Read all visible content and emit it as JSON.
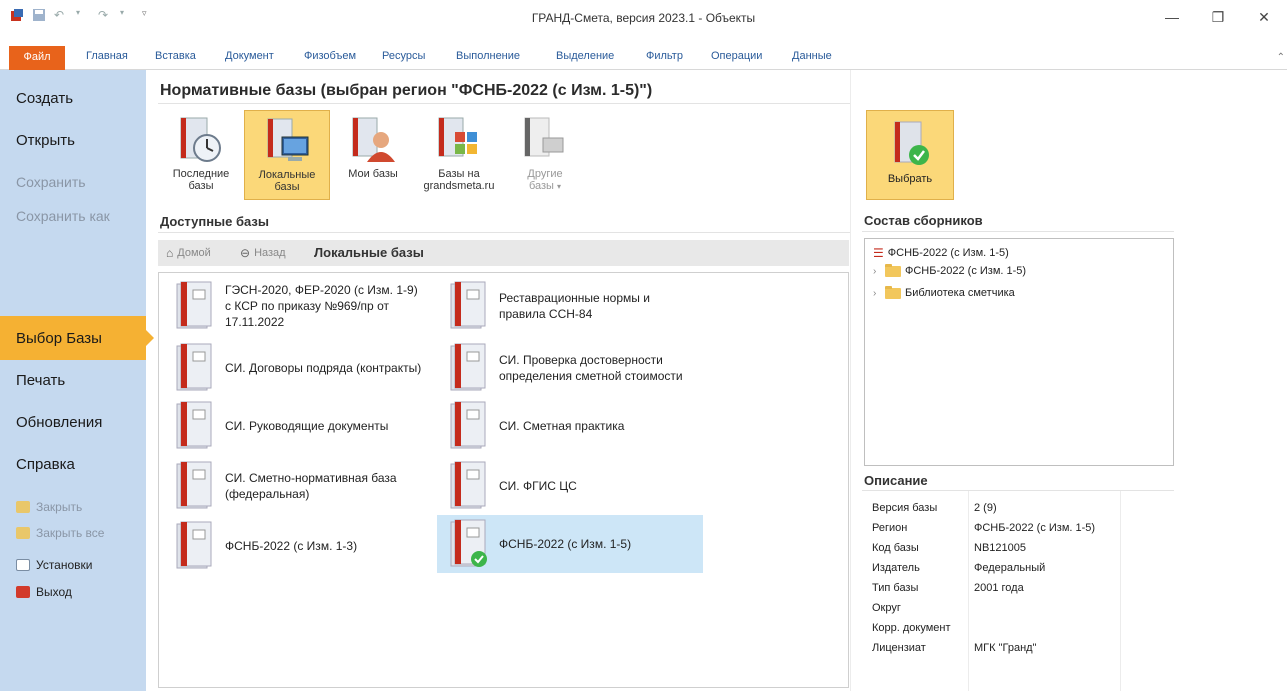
{
  "window": {
    "title": "ГРАНД-Смета, версия 2023.1 - Объекты",
    "minimize": "—",
    "restore": "❐",
    "close": "✕"
  },
  "ribbon": {
    "file_tab": "Файл",
    "tabs": [
      "Главная",
      "Вставка",
      "Документ",
      "Физобъем",
      "Ресурсы",
      "Выполнение",
      "Выделение",
      "Фильтр",
      "Операции",
      "Данные"
    ]
  },
  "nav": {
    "items": [
      "Создать",
      "Открыть",
      "Сохранить",
      "Сохранить как",
      "Выбор Базы",
      "Печать",
      "Обновления",
      "Справка"
    ],
    "small_items": [
      "Закрыть",
      "Закрыть все",
      "Установки",
      "Выход"
    ]
  },
  "main": {
    "title": "Нормативные базы (выбран регион \"ФСНБ-2022 (с Изм. 1-5)\")",
    "sources": [
      {
        "label1": "Последние",
        "label2": "базы"
      },
      {
        "label1": "Локальные",
        "label2": "базы"
      },
      {
        "label1": "Мои базы",
        "label2": ""
      },
      {
        "label1": "Базы на",
        "label2": "grandsmeta.ru"
      },
      {
        "label1": "Другие",
        "label2": "базы"
      }
    ],
    "available_title": "Доступные базы",
    "crumb_home": "Домой",
    "crumb_back": "Назад",
    "crumb_title": "Локальные базы",
    "databases": [
      "ГЭСН-2020, ФЕР-2020 (с Изм. 1-9) с КСР по приказу №969/пр от 17.11.2022",
      "Реставрационные нормы и правила ССН-84",
      "СИ. Договоры подряда (контракты)",
      "СИ. Проверка достоверности определения сметной стоимости",
      "СИ. Руководящие документы",
      "СИ. Сметная практика",
      "СИ. Сметно-нормативная база (федеральная)",
      "СИ. ФГИС ЦС",
      "ФСНБ-2022 (с Изм. 1-3)",
      "ФСНБ-2022 (с Изм. 1-5)"
    ]
  },
  "right": {
    "choose_label": "Выбрать",
    "composition_title": "Состав сборников",
    "tree": [
      "ФСНБ-2022 (с Изм. 1-5)",
      "ФСНБ-2022 (с Изм. 1-5)",
      "Библиотека сметчика"
    ],
    "description_title": "Описание",
    "description": [
      {
        "key": "Версия базы",
        "value": "2 (9)"
      },
      {
        "key": "Регион",
        "value": "ФСНБ-2022 (с Изм. 1-5)"
      },
      {
        "key": "Код базы",
        "value": "NB121005"
      },
      {
        "key": "Издатель",
        "value": "Федеральный"
      },
      {
        "key": "Тип базы",
        "value": "2001 года"
      },
      {
        "key": "Округ",
        "value": ""
      },
      {
        "key": "Корр. документ",
        "value": ""
      },
      {
        "key": "Лицензиат",
        "value": "МГК \"Гранд\""
      }
    ]
  },
  "colors": {
    "accent_orange": "#e8631b",
    "selected_yellow": "#fbd879",
    "nav_bg": "#c5d9ef",
    "selection_blue": "#cde6f7"
  }
}
